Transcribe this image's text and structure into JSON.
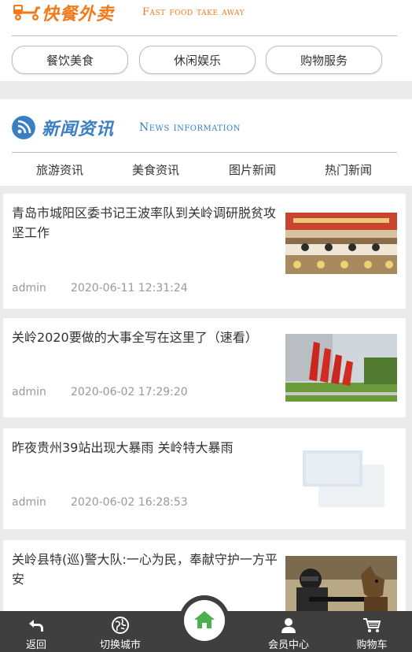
{
  "fastfood": {
    "title_cn": "快餐外卖",
    "title_en": "Fast food take away",
    "buttons": [
      "餐饮美食",
      "休闲娱乐",
      "购物服务"
    ],
    "accent_color": "#f27a1a"
  },
  "news": {
    "title_cn": "新闻资讯",
    "title_en": "News information",
    "tabs": [
      "旅游资讯",
      "美食资讯",
      "图片新闻",
      "热门新闻"
    ],
    "accent_color": "#3a7fc4"
  },
  "articles": [
    {
      "title": "青岛市城阳区委书记王波率队到关岭调研脱贫攻坚工作",
      "author": "admin",
      "date": "2020-06-11 12:31:24",
      "thumb_icon": "meeting-photo"
    },
    {
      "title": "关岭2020要做的大事全写在这里了（速看）",
      "author": "admin",
      "date": "2020-06-02 17:29:20",
      "thumb_icon": "red-monument-photo"
    },
    {
      "title": "昨夜贵州39站出现大暴雨 关岭特大暴雨",
      "author": "admin",
      "date": "2020-06-02 16:28:53",
      "thumb_icon": "placeholder-image"
    },
    {
      "title": "关岭县特(巡)警大队:一心为民，奉献守护一方平安",
      "author": "",
      "date": "",
      "thumb_icon": "police-dog-photo"
    }
  ],
  "bottom_nav": {
    "back": "返回",
    "switch_city": "切换城市",
    "home_icon": "home-icon",
    "member": "会员中心",
    "cart": "购物车"
  }
}
